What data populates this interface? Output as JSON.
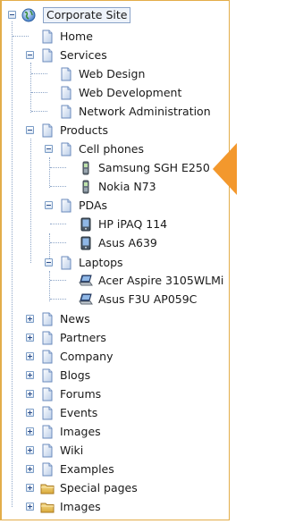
{
  "tree": {
    "root": {
      "label": "Corporate Site",
      "icon": "globe-icon"
    },
    "home": {
      "label": "Home"
    },
    "services": {
      "label": "Services",
      "children": {
        "web_design": "Web Design",
        "web_development": "Web Development",
        "network_administration": "Network Administration"
      }
    },
    "products": {
      "label": "Products",
      "cell_phones": {
        "label": "Cell phones",
        "items": {
          "samsung": "Samsung SGH E250",
          "nokia": "Nokia N73"
        }
      },
      "pdas": {
        "label": "PDAs",
        "items": {
          "hp": "HP iPAQ 114",
          "asus_a639": "Asus A639"
        }
      },
      "laptops": {
        "label": "Laptops",
        "items": {
          "acer": "Acer Aspire 3105WLMi",
          "asus_f3u": "Asus F3U AP059C"
        }
      }
    },
    "collapsed": {
      "news": "News",
      "partners": "Partners",
      "company": "Company",
      "blogs": "Blogs",
      "forums": "Forums",
      "events": "Events",
      "images": "Images",
      "wiki": "Wiki",
      "examples": "Examples",
      "special_pages": "Special pages",
      "images_folder": "Images"
    }
  },
  "colors": {
    "accent": "#f3982d",
    "tree_line": "#8ea6c8",
    "border": "#e3ad49"
  }
}
